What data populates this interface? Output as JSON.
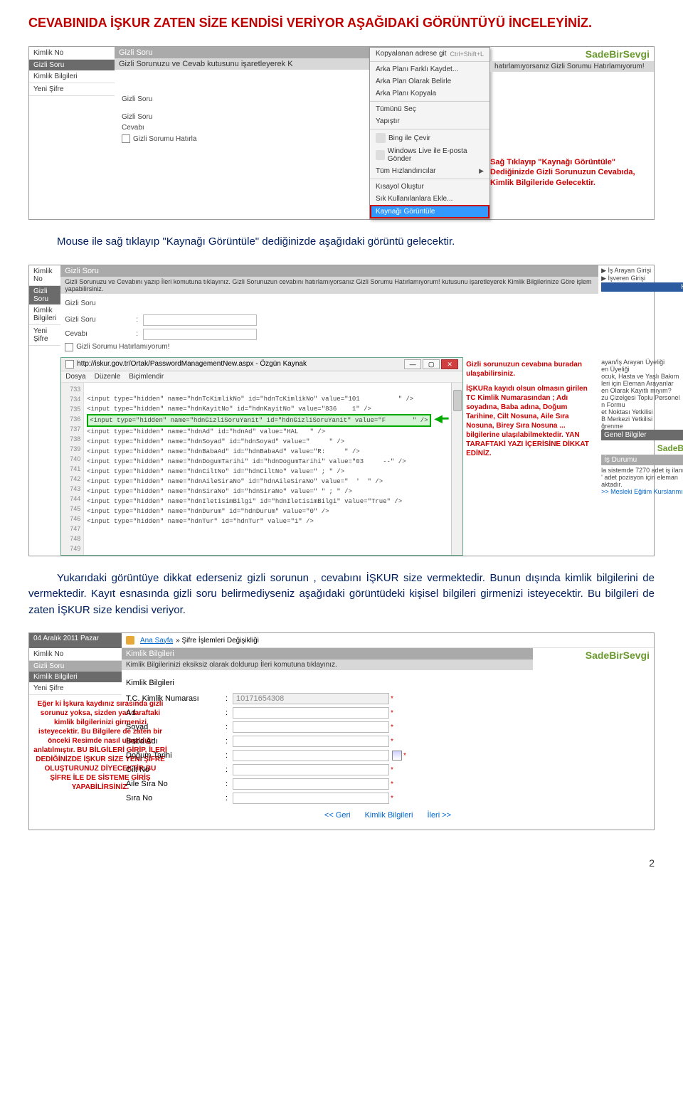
{
  "doc": {
    "heading1": "CEVABINIDA İŞKUR ZATEN SİZE KENDİSİ VERİYOR AŞAĞIDAKİ GÖRÜNTÜYÜ İNCELEYİNİZ.",
    "para1": "Mouse ile sağ tıklayıp \"Kaynağı Görüntüle\" dediğinizde aşağıdaki görüntü gelecektir.",
    "para2a": "Yukarıdaki görüntüye dikkat ederseniz gizli sorunun , cevabını İŞKUR size vermektedir. Bunun dışında kimlik bilgilerini de vermektedir. Kayıt esnasında gizli soru belirmediyseniz aşağıdaki görüntüdeki kişisel bilgileri girmenizi isteyecektir. Bu bilgileri de zaten İŞKUR size kendisi veriyor.",
    "page_number": "2"
  },
  "ss1": {
    "watermark": "SadeBirSevgi",
    "sidebar": {
      "kno": "Kimlik No",
      "gs": "Gizli Soru",
      "kb": "Kimlik Bilgileri",
      "ys": "Yeni Şifre"
    },
    "title_gs": "Gizli Soru",
    "desc": "Gizli Sorunuzu ve Cevab kutusunu işaretleyerek K",
    "desc_tail": "hatırlamıyorsanız Gizli Sorumu Hatırlamıyorum!",
    "labels": {
      "gs": "Gizli Soru",
      "cv": "Cevabı",
      "chk": "Gizli Sorumu Hatırla"
    },
    "cm": {
      "copy_addr": "Kopyalanan adrese git",
      "copy_sc": "Ctrl+Shift+L",
      "saveas": "Arka Planı Farklı Kaydet...",
      "setbg": "Arka Plan Olarak Belirle",
      "copybg": "Arka Planı Kopyala",
      "selall": "Tümünü Seç",
      "paste": "Yapıştır",
      "bing": "Bing ile Çevir",
      "wlive": "Windows Live ile E-posta Gönder",
      "accel": "Tüm Hızlandırıcılar",
      "shortcut": "Kısayol Oluştur",
      "addfav": "Sık Kullanılanlara Ekle...",
      "viewsrc": "Kaynağı Görüntüle"
    },
    "note": "Sağ Tıklayıp \"Kaynağı Görüntüle\" Dediğinizde Gizli Sorunuzun Cevabıda, Kimlik Bilgileride Gelecektir."
  },
  "ss2": {
    "watermark": "SadeBirSevgi",
    "sidebar": {
      "kno": "Kimlik No",
      "gs": "Gizli Soru",
      "kb": "Kimlik Bilgileri",
      "ys": "Yeni Şifre"
    },
    "title_gs": "Gizli Soru",
    "desc_full": "Gizli Sorunuzu ve Cevabını yazıp İleri komutuna tıklayınız. Gizli Sorunuzun cevabını hatırlamıyorsanız Gizli Sorumu Hatırlamıyorum! kutusunu işaretleyerek Kimlik Bilgilerinize Göre işlem yapabilirsiniz.",
    "labels": {
      "gs": "Gizli Soru",
      "cv": "Cevabı",
      "chk": "Gizli Sorumu Hatırlamıyorum!"
    },
    "src_title": "http://iskur.gov.tr/Ortak/PasswordManagementNew.aspx - Özgün Kaynak",
    "menus": {
      "file": "Dosya",
      "edit": "Düzenle",
      "format": "Biçimlendir"
    },
    "lines": [
      "733",
      "734",
      "735",
      "736",
      "737",
      "738",
      "739",
      "740",
      "741",
      "742",
      "743",
      "744",
      "745",
      "746",
      "747",
      "748",
      "749"
    ],
    "code": {
      "l733": "<input type=\"hidden\" name=\"hdnTcKimlikNo\" id=\"hdnTcKimlikNo\" value=\"101          \" />",
      "l734": "<input type=\"hidden\" name=\"hdnKayitNo\" id=\"hdnKayitNo\" value=\"836    1\" />",
      "l735_hi": "<input type=\"hidden\" name=\"hdnGizliSoruYanit\" id=\"hdnGizliSoruYanit\" value=\"F       \" />",
      "l737": "<input type=\"hidden\" name=\"hdnAd\" id=\"hdnAd\" value=\"HAL   \" />",
      "l738": "<input type=\"hidden\" name=\"hdnSoyad\" id=\"hdnSoyad\" value=\"     \" />",
      "l739": "<input type=\"hidden\" name=\"hdnBabaAd\" id=\"hdnBabaAd\" value=\"R:     \" />",
      "l740": "<input type=\"hidden\" name=\"hdnDogumTarihi\" id=\"hdnDogumTarihi\" value=\"03     --\" />",
      "l741": "<input type=\"hidden\" name=\"hdnCiltNo\" id=\"hdnCiltNo\" value=\" ; \" />",
      "l742": "<input type=\"hidden\" name=\"hdnAileSiraNo\" id=\"hdnAileSiraNo\" value=\"  '  \" />",
      "l743": "<input type=\"hidden\" name=\"hdnSiraNo\" id=\"hdnSiraNo\" value=\" \" ; \" />",
      "l744": "<input type=\"hidden\" name=\"hdnIletisimBilgi\" id=\"hdnIletisimBilgi\" value=\"True\" />",
      "l745": "<input type=\"hidden\" name=\"hdnDurum\" id=\"hdnDurum\" value=\"0\" />",
      "l746": "<input type=\"hidden\" name=\"hdnTur\" id=\"hdnTur\" value=\"1\" />"
    },
    "note_top": "Gizli sorunuzun cevabına buradan ulaşabilirsiniz.",
    "note_mid": "İŞKURa kayıdı olsun olmasın girilen TC Kimlik Numarasından ; Adı soyadına, Baba adına, Doğum Tarihine, Cilt Nosuna, Aile Sıra Nosuna, Birey Sıra Nosuna ... bilgilerine ulaşılabilmektedir. YAN TARAFTAKİ YAZI İÇERİSİNE DİKKAT EDİNİZ.",
    "right": {
      "isarayan": "İş Arayan Girişi",
      "isveren": "İşveren Girişi",
      "kisayollar": "Kısayollar",
      "items": "ayan/İş Arayan Üyeliği\nen Üyeliği\nocuk, Hasta ve Yaşlı Bakım\nleri için Eleman Arayanlar\nen Olarak Kayıtlı mıyım?\nzu Çizelgesi Toplu Personel\nn Formu\net Noktası Yetkilisi\nB Merkezi Yetkilisi\nğrenme",
      "genel": "Genel Bilgiler",
      "watermark": "SadeBirSevgi",
      "isdurumu": "İş Durumu",
      "isdurumu_txt": "la sistemde 7270 adet iş ilanı ile\n' adet pozisyon için eleman\naktadır.",
      "mesleki": ">> Mesleki Eğitim Kurslarımız"
    }
  },
  "ss3": {
    "date": "04 Aralık 2011 Pazar",
    "bc": {
      "ana": "Ana Sayfa",
      "sep": "» Şifre İşlemleri Değişikliği"
    },
    "sidebar": {
      "kno": "Kimlik No",
      "gs": "Gizli Soru",
      "kb": "Kimlik Bilgileri",
      "ys": "Yeni Şifre"
    },
    "watermark": "SadeBirSevgi",
    "title": "Kimlik Bilgileri",
    "desc": "Kimlik Bilgilerinizi eksiksiz olarak doldurup İleri komutuna tıklayınız.",
    "subtitle": "Kimlik Bilgileri",
    "fields": {
      "tc": "T.C. Kimlik Numarası",
      "tc_val": "10171654308",
      "ad": "Ad",
      "soyad": "Soyad",
      "baba": "Baba Adı",
      "dogum": "Doğum Tarihi",
      "cilt": "Cilt No",
      "aile": "Aile Sıra No",
      "sira": "Sıra No"
    },
    "links": {
      "geri": "<< Geri",
      "kb": "Kimlik Bilgileri",
      "ileri": "İleri >>"
    },
    "left_note": "Eğer ki İşkura kaydınız sırasında gizli sorunuz yoksa, sizden yan taraftaki kimlik bilgilerinizi girmenizi isteyecektir. Bu Bilgilere de zaten bir önceki Resimde nasıl ulaşıldığı anlatılmıştır. BU BİLGİLERİ GİRİP, İLERİ DEDİĞİNİZDE İŞKUR SİZE YENİ ŞİFRE OLUŞTURUNUZ DİYECEKTİR.BU ŞİFRE İLE DE SİSTEME GİRİŞ YAPABİLİRSİNİZ."
  }
}
